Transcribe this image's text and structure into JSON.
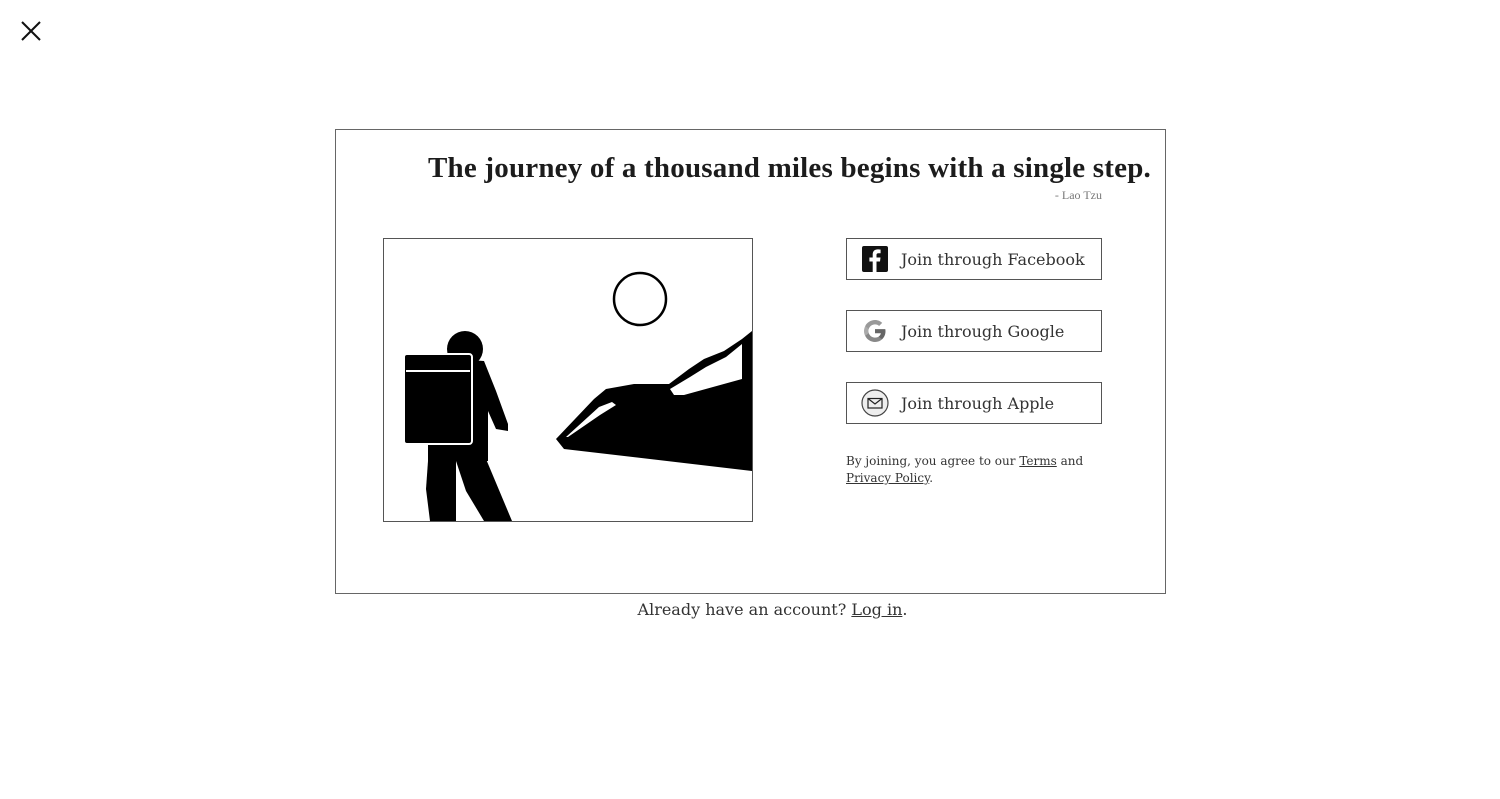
{
  "close": {
    "icon": "close-icon"
  },
  "quote": {
    "text": "The journey of a thousand miles begins with a single step.",
    "author": "- Lao Tzu"
  },
  "illustration": {
    "icon": "hiker-mountain-illustration"
  },
  "auth_buttons": [
    {
      "label": "Join through Facebook",
      "icon": "facebook-icon"
    },
    {
      "label": "Join through Google",
      "icon": "google-icon"
    },
    {
      "label": "Join through Apple",
      "icon": "mail-icon"
    }
  ],
  "legal": {
    "prefix": "By joining, you agree to our ",
    "terms": "Terms",
    "and": " and",
    "privacy": "Privacy Policy",
    "suffix": "."
  },
  "footer": {
    "prefix": "Already have an account? ",
    "login": "Log in",
    "suffix": "."
  }
}
